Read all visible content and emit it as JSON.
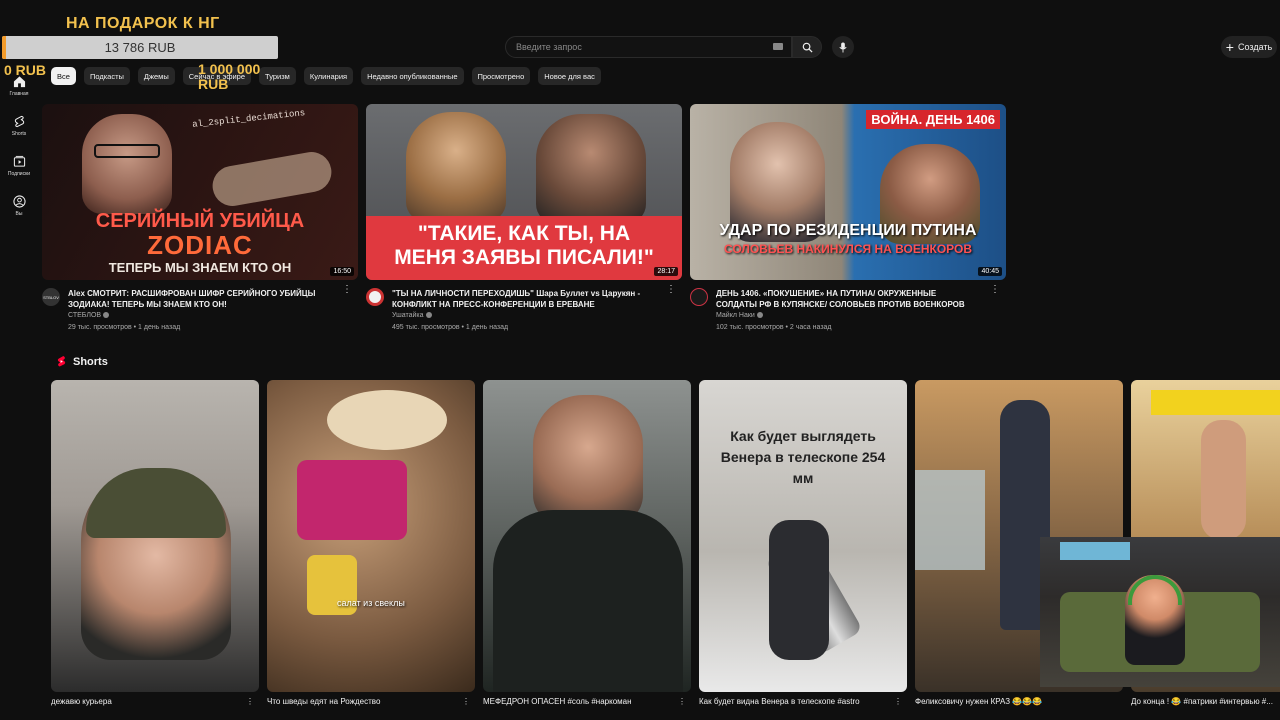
{
  "donation": {
    "title": "НА ПОДАРОК К НГ",
    "amount": "13 786 RUB",
    "min": "0 RUB",
    "max": "1 000 000 RUB",
    "progress_fraction": 0.0138,
    "color_fill": "#f29b2b",
    "color_text": "#f2c14e"
  },
  "header": {
    "search_placeholder": "Введите запрос",
    "create_label": "Создать"
  },
  "sidebar": {
    "items": [
      {
        "label": "Главная",
        "icon": "home-icon"
      },
      {
        "label": "Shorts",
        "icon": "shorts-icon"
      },
      {
        "label": "Подписки",
        "icon": "subscriptions-icon"
      },
      {
        "label": "Вы",
        "icon": "you-icon"
      }
    ]
  },
  "chips": [
    "Все",
    "Подкасты",
    "Джемы",
    "Сейчас в эфире",
    "Туризм",
    "Кулинария",
    "Недавно опубликованные",
    "Просмотрено",
    "Новое для вас"
  ],
  "videos": [
    {
      "title": "Alex СМОТРИТ: РАСШИФРОВАН ШИФР СЕРИЙНОГО УБИЙЦЫ ЗОДИАКА! ТЕПЕРЬ МЫ ЗНАЕМ КТО ОН!",
      "channel": "СТЕБЛОВ",
      "stats": "29 тыс. просмотров • 1 день назад",
      "duration": "16:50",
      "thumb_line1": "СЕРИЙНЫЙ УБИЙЦА",
      "thumb_line2": "ZODIAC",
      "thumb_line3": "ТЕПЕРЬ МЫ ЗНАЕМ КТО ОН",
      "thumb_code": "al_2split_decimations",
      "avatar_label": "STBLOV"
    },
    {
      "title": "\"ТЫ НА ЛИЧНОСТИ ПЕРЕХОДИШЬ\" Шара Буллет vs Царукян - КОНФЛИКТ НА ПРЕСС-КОНФЕРЕНЦИИ В ЕРЕВАНЕ",
      "channel": "Ушатайка",
      "stats": "495 тыс. просмотров • 1 день назад",
      "duration": "28:17",
      "thumb_line1": "\"ТАКИЕ, КАК ТЫ, НА",
      "thumb_line2": "МЕНЯ ЗАЯВЫ ПИСАЛИ!\""
    },
    {
      "title": "ДЕНЬ 1406. «ПОКУШЕНИЕ» НА ПУТИНА/ ОКРУЖЕННЫЕ СОЛДАТЫ РФ В КУПЯНСКЕ/ СОЛОВЬЕВ ПРОТИВ ВОЕНКОРОВ",
      "channel": "Майкл Наки",
      "stats": "102 тыс. просмотров • 2 часа назад",
      "duration": "40:45",
      "thumb_badge": "ВОЙНА. ДЕНЬ 1406",
      "thumb_line1": "УДАР ПО РЕЗИДЕНЦИИ ПУТИНА",
      "thumb_line2": "СОЛОВЬЕВ НАКИНУЛСЯ НА ВОЕНКОРОВ"
    }
  ],
  "shorts_heading": "Shorts",
  "shorts": [
    {
      "title": "дежавю курьера"
    },
    {
      "title": "Что шведы едят на Рождество",
      "overlay": "салат из свеклы"
    },
    {
      "title": "МЕФЕДРОН ОПАСЕН #соль #наркоман"
    },
    {
      "title": "Как будет видна Венера в телескопе #astro",
      "overlay": "Как будет выглядеть Венера в телескопе 254 мм"
    },
    {
      "title": "Феликсовичу нужен КРАЗ 😂😂😂"
    },
    {
      "title": "До конца ! 😂 #патрики #интервью #..."
    }
  ]
}
